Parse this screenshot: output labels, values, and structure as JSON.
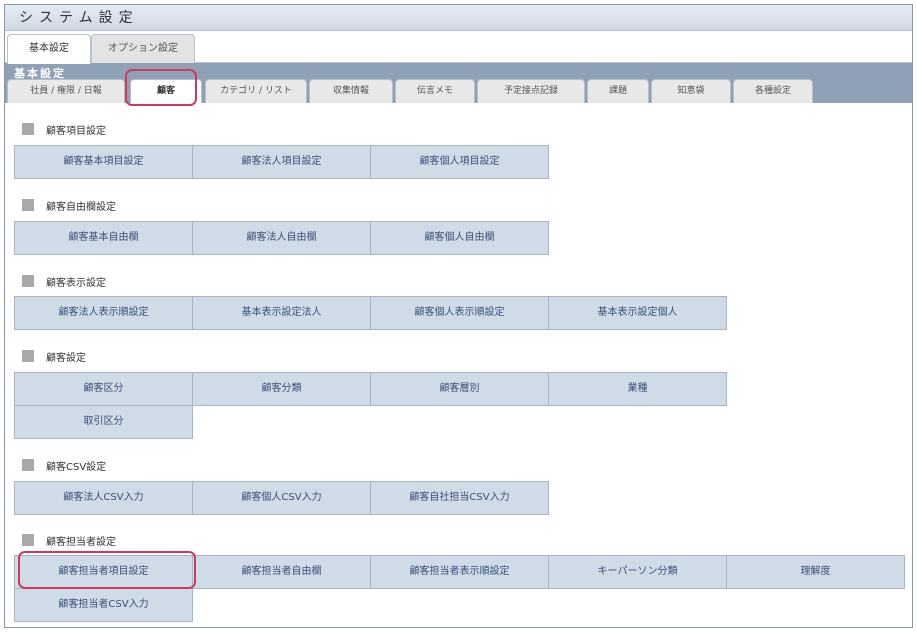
{
  "window": {
    "title": "システム設定"
  },
  "top_tabs": [
    {
      "label": "基本設定",
      "active": true
    },
    {
      "label": "オプション設定",
      "active": false
    }
  ],
  "section": {
    "label": "基本設定",
    "tabs": [
      {
        "label": "社員 / 権限 / 日報",
        "active": false
      },
      {
        "label": "顧客",
        "active": true
      },
      {
        "label": "カテゴリ / リスト",
        "active": false
      },
      {
        "label": "収集情報",
        "active": false
      },
      {
        "label": "伝言メモ",
        "active": false
      },
      {
        "label": "予定接点記録",
        "active": false
      },
      {
        "label": "課題",
        "active": false
      },
      {
        "label": "知恵袋",
        "active": false
      },
      {
        "label": "各種設定",
        "active": false
      }
    ]
  },
  "groups": [
    {
      "title": "顧客項目設定",
      "rows": [
        [
          "顧客基本項目設定",
          "顧客法人項目設定",
          "顧客個人項目設定"
        ]
      ]
    },
    {
      "title": "顧客自由欄設定",
      "rows": [
        [
          "顧客基本自由欄",
          "顧客法人自由欄",
          "顧客個人自由欄"
        ]
      ]
    },
    {
      "title": "顧客表示設定",
      "rows": [
        [
          "顧客法人表示順設定",
          "基本表示設定法人",
          "顧客個人表示順設定",
          "基本表示設定個人"
        ]
      ]
    },
    {
      "title": "顧客設定",
      "rows": [
        [
          "顧客区分",
          "顧客分類",
          "顧客層別",
          "業種"
        ],
        [
          "取引区分"
        ]
      ]
    },
    {
      "title": "顧客CSV設定",
      "rows": [
        [
          "顧客法人CSV入力",
          "顧客個人CSV入力",
          "顧客自社担当CSV入力"
        ]
      ]
    },
    {
      "title": "顧客担当者設定",
      "rows": [
        [
          "顧客担当者項目設定",
          "顧客担当者自由欄",
          "顧客担当者表示順設定",
          "キーパーソン分類",
          "理解度"
        ],
        [
          "顧客担当者CSV入力"
        ]
      ]
    }
  ],
  "colors": {
    "highlight": "#cc3b5e",
    "section_bar": "#8ea1b7",
    "button_bg": "#cfdbe6",
    "button_text": "#3b4f7a"
  }
}
